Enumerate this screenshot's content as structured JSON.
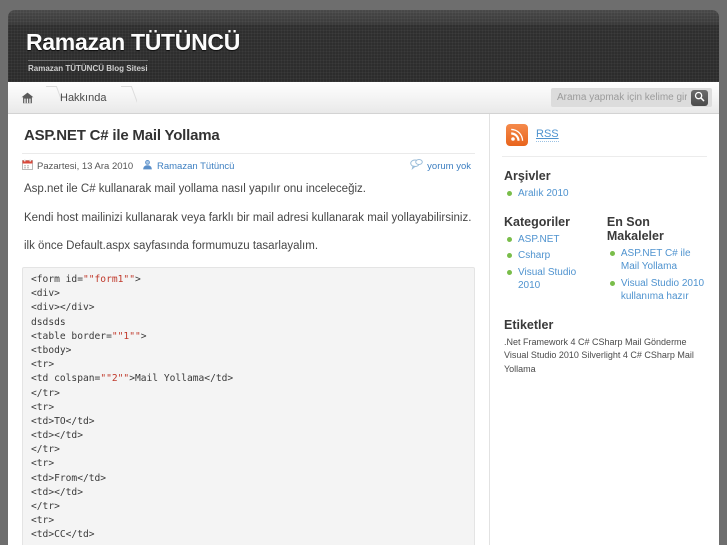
{
  "header": {
    "title": "Ramazan TÜTÜNCÜ",
    "tagline": "Ramazan TÜTÜNCÜ Blog Sitesi"
  },
  "nav": {
    "home_icon": "home-icon",
    "items": [
      {
        "label": "Hakkında"
      }
    ]
  },
  "search": {
    "placeholder": "Arama yapmak için kelime giriniz.",
    "value": "",
    "icon": "search-icon"
  },
  "post": {
    "title": "ASP.NET C# ile Mail Yollama",
    "date": "Pazartesi, 13 Ara 2010",
    "date_icon": "calendar-icon",
    "author": "Ramazan Tütüncü",
    "author_icon": "user-icon",
    "comments": "yorum yok",
    "comments_icon": "comment-bubble-icon",
    "paragraphs": [
      "Asp.net ile C# kullanarak mail yollama nasıl yapılır onu inceleceğiz.",
      "Kendi host mailinizi kullanarak veya farklı bir mail adresi kullanarak mail yollayabilirsiniz.",
      "ilk önce Default.aspx sayfasında formumuzu tasarlayalım."
    ],
    "code": "<form id=\"\"form1\"\">\n<div>\n<div></div>\ndsdsds\n<table border=\"\"1\"\">\n<tbody>\n<tr>\n<td colspan=\"\"2\"\">Mail Yollama</td>\n</tr>\n<tr>\n<td>TO</td>\n<td></td>\n</tr>\n<tr>\n<td>From</td>\n<td></td>\n</tr>\n<tr>\n<td>CC</td>"
  },
  "sidebar": {
    "rss": {
      "label": "RSS",
      "icon": "rss-icon"
    },
    "arsivler": {
      "heading": "Arşivler",
      "items": [
        {
          "label": "Aralık 2010"
        }
      ]
    },
    "kategoriler": {
      "heading": "Kategoriler",
      "items": [
        {
          "label": "ASP.NET"
        },
        {
          "label": "Csharp"
        },
        {
          "label": "Visual Studio 2010"
        }
      ]
    },
    "makaleler": {
      "heading": "En Son Makaleler",
      "items": [
        {
          "label": "ASP.NET C# ile Mail Yollama"
        },
        {
          "label": "Visual Studio 2010 kullanıma hazır"
        }
      ]
    },
    "etiketler": {
      "heading": "Etiketler",
      "tags": ".Net Framework 4 C# CSharp Mail Gönderme Visual Studio 2010 Silverlight 4 C# CSharp Mail Yollama"
    }
  },
  "colors": {
    "link": "#4f93cf",
    "bullet": "#79bd4a",
    "rss_orange": "#e8641c",
    "header_dark": "#2c2c2c",
    "code_red": "#c0392b"
  }
}
